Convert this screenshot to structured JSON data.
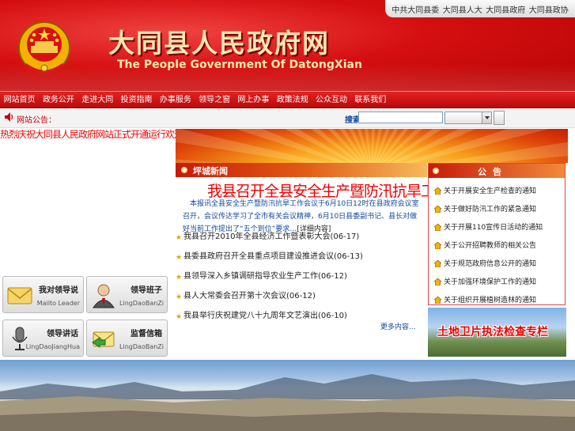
{
  "header": {
    "title": "大同县人民政府网",
    "subtitle": "The People Government Of DatongXian",
    "top_links": [
      "中共大同县委",
      "大同县人大",
      "大同县政府",
      "大同县政协"
    ]
  },
  "nav": {
    "items": [
      "网站首页",
      "政务公开",
      "走进大同",
      "投资指南",
      "办事服务",
      "领导之窗",
      "网上办事",
      "政策法规",
      "公众互动",
      "联系我们"
    ]
  },
  "search": {
    "notice_label": "网站公告：",
    "label": "搜索",
    "input_value": "",
    "select_value": ""
  },
  "marquee": {
    "text": "热烈庆祝大同县人民政府网站正式开通运行欢迎广大群众积极参与网站建设"
  },
  "news": {
    "section_title": "坪城新闻",
    "headline": "我县召开全县安全生产暨防汛抗旱工作会议",
    "summary": "本报讯全县安全生产暨防汛抗旱工作会议于6月10日12时在县政府会议室召开，会议传达学习了全市有关会议精神，6月10日县委副书记、县长对做好当前工作提出了“五个到位”要求…",
    "summary_more": "[详细内容]",
    "items": [
      {
        "text": "我县召开2010年全县经济工作暨表彰大会",
        "date": "(06-17)"
      },
      {
        "text": "县委县政府召开全县重点项目建设推进会议",
        "date": "(06-13)"
      },
      {
        "text": "县领导深入乡镇调研指导农业生产工作",
        "date": "(06-12)"
      },
      {
        "text": "县人大常委会召开第十次会议",
        "date": "(06-12)"
      },
      {
        "text": "我县举行庆祝建党八十九周年文艺演出",
        "date": "(06-10)"
      }
    ],
    "more_label": "更多内容..."
  },
  "notice": {
    "title": "公告",
    "items": [
      "关于开展安全生产检查的通知",
      "关于做好防汛工作的紧急通知",
      "关于开展110宣传日活动的通知",
      "关于公开招聘教师的相关公告",
      "关于规范政府信息公开的通知",
      "关于加强环境保护工作的通知",
      "关于组织开展植树造林的通知"
    ]
  },
  "land_banner": {
    "label": "土地卫片执法检查专栏"
  },
  "left_buttons": [
    {
      "cn": "我对领导说",
      "en": "Mailto Leader",
      "icon": "envelope-icon"
    },
    {
      "cn": "领导班子",
      "en": "LingDaoBanZi",
      "icon": "person-icon"
    },
    {
      "cn": "领导讲话",
      "en": "LingDaoJiangHua",
      "icon": "microphone-icon"
    },
    {
      "cn": "监督信箱",
      "en": "LingDaoBanZi",
      "icon": "mail-arrow-icon"
    }
  ],
  "colors": {
    "brand_red": "#d50f10",
    "title_gold": "#fde7b0",
    "link_blue": "#1148a0",
    "headline_red": "#e00000"
  }
}
